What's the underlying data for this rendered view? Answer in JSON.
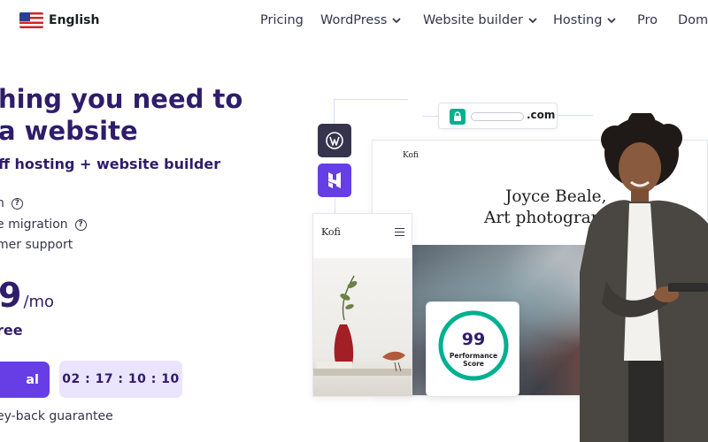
{
  "header": {
    "language": "English",
    "nav": [
      {
        "label": "Pricing",
        "has_dropdown": false
      },
      {
        "label": "WordPress",
        "has_dropdown": true
      },
      {
        "label": "Website builder",
        "has_dropdown": true
      },
      {
        "label": "Hosting",
        "has_dropdown": true
      },
      {
        "label": "Pro",
        "has_dropdown": false
      },
      {
        "label": "Doma",
        "has_dropdown": false
      }
    ]
  },
  "hero": {
    "title_line1": "hing you need to",
    "title_line2": "a website",
    "subtitle": "ff hosting + website builder",
    "features": [
      "n",
      "e migration",
      "mer support"
    ],
    "price": "9",
    "price_period": "/mo",
    "bonus": "ree",
    "cta_label": "al",
    "countdown": "02 : 17 : 10 : 10",
    "guarantee": "ey-back guarantee"
  },
  "illustration": {
    "url_tld": ".com",
    "desktop_brand": "Kofi",
    "desktop_headline_line1": "Joyce Beale,",
    "desktop_headline_line2": "Art photograpl",
    "mobile_brand": "Kofi",
    "performance_score": "99",
    "performance_label_line1": "Performance",
    "performance_label_line2": "Score",
    "performance_fraction": 0.99
  },
  "colors": {
    "brand_purple": "#673de6",
    "heading_navy": "#2f1c6a",
    "timer_bg": "#ebe4ff",
    "success_green": "#00b090"
  },
  "icons": [
    "us-flag-icon",
    "chevron-down-icon",
    "question-circle-icon",
    "lock-icon",
    "wordpress-icon",
    "hostinger-builder-icon",
    "hamburger-menu-icon"
  ]
}
